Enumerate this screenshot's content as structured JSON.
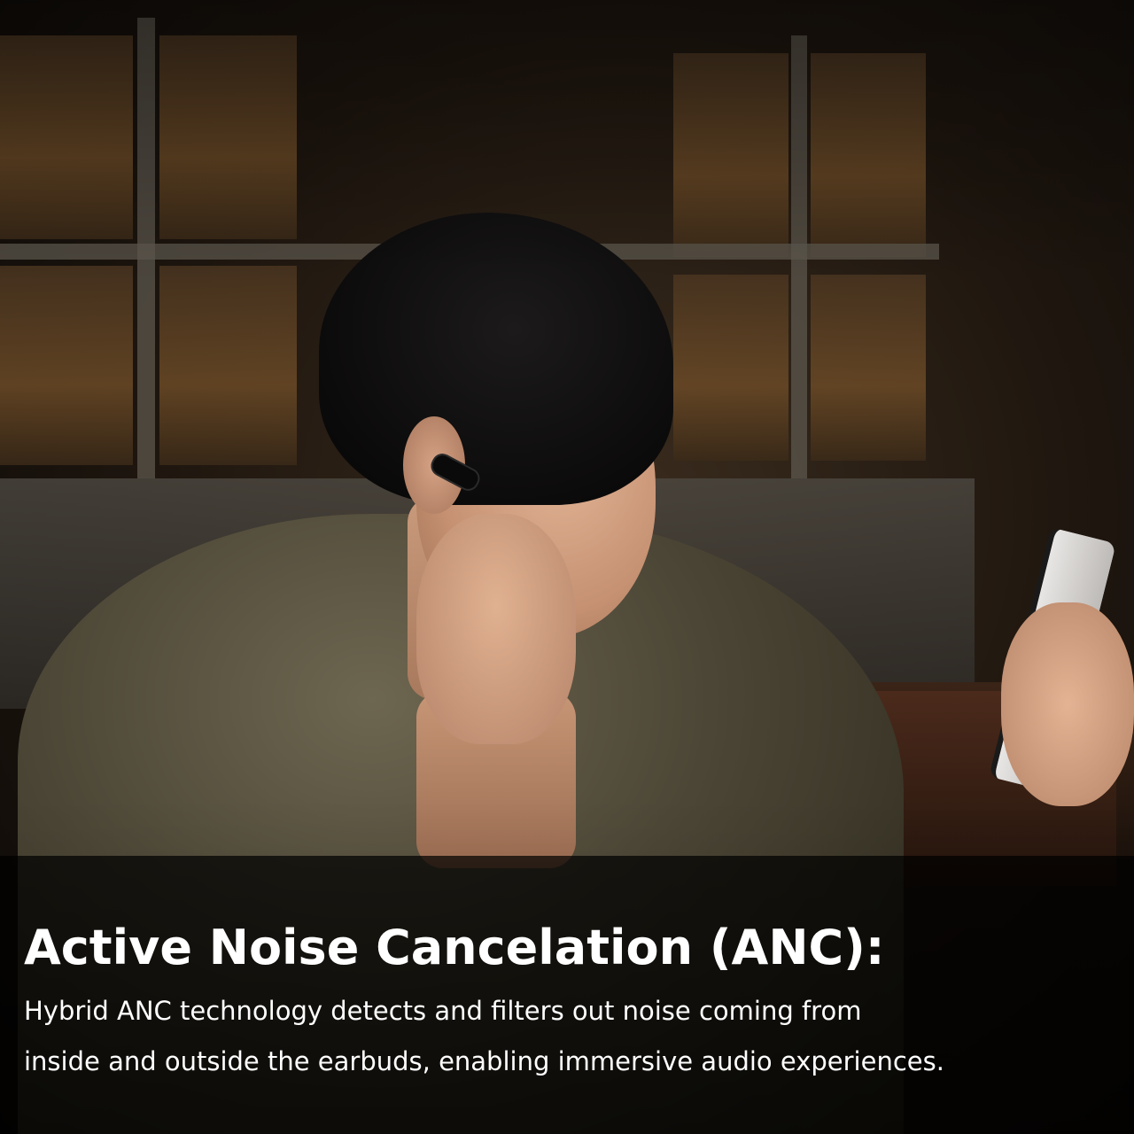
{
  "caption": {
    "title": "Active Noise Cancelation (ANC):",
    "body_line_1": "Hybrid ANC technology detects and filters out noise coming from",
    "body_line_2": "inside and outside the earbuds, enabling immersive audio experiences."
  },
  "colors": {
    "caption_text": "#ffffff",
    "caption_band": "#000000"
  }
}
